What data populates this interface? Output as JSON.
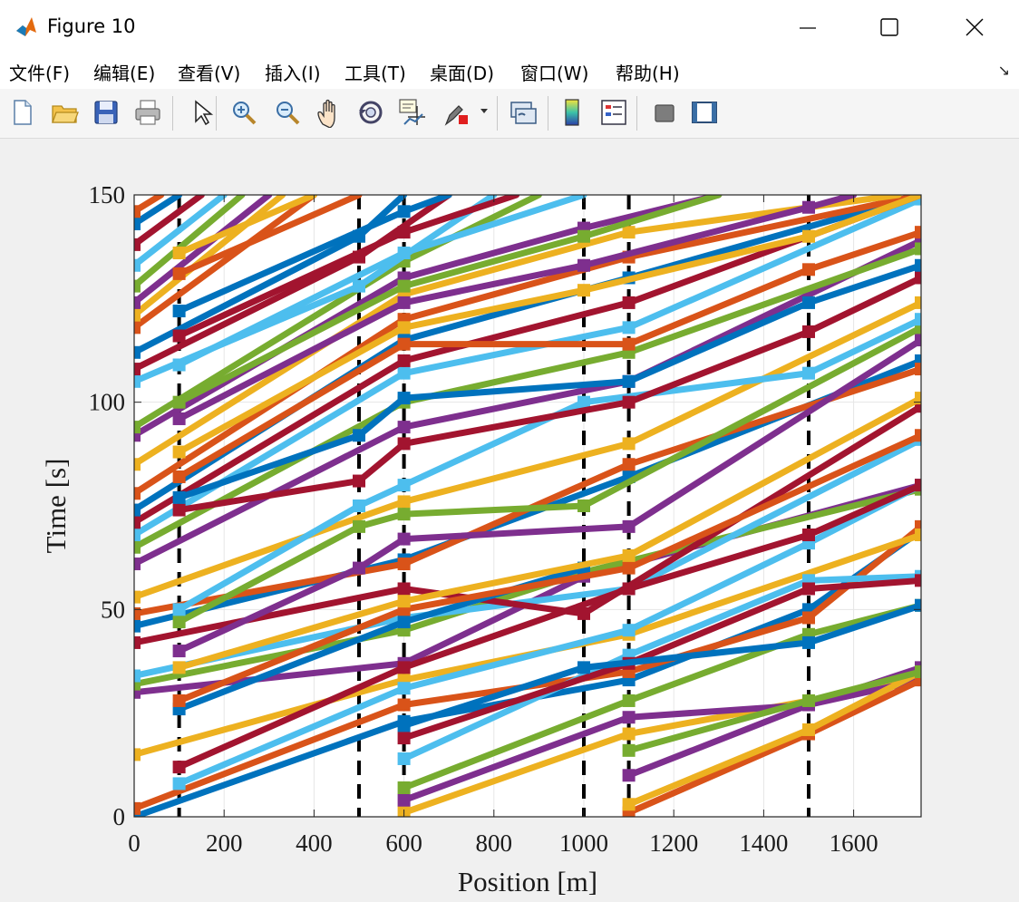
{
  "window": {
    "title": "Figure 10"
  },
  "menu": [
    {
      "label": "文件(F)",
      "x": 10
    },
    {
      "label": "编辑(E)",
      "x": 103
    },
    {
      "label": "查看(V)",
      "x": 196
    },
    {
      "label": "插入(I)",
      "x": 292
    },
    {
      "label": "工具(T)",
      "x": 380
    },
    {
      "label": "桌面(D)",
      "x": 474
    },
    {
      "label": "窗口(W)",
      "x": 574
    },
    {
      "label": "帮助(H)",
      "x": 679
    }
  ],
  "toolbar": [
    {
      "name": "new-figure-icon"
    },
    {
      "name": "open-file-icon"
    },
    {
      "name": "save-icon"
    },
    {
      "name": "print-icon"
    },
    {
      "name": "pointer-icon"
    },
    {
      "name": "zoom-in-icon"
    },
    {
      "name": "zoom-out-icon"
    },
    {
      "name": "pan-icon"
    },
    {
      "name": "rotate-3d-icon"
    },
    {
      "name": "data-cursor-icon"
    },
    {
      "name": "brush-icon"
    },
    {
      "name": "link-plot-icon"
    },
    {
      "name": "colorbar-icon"
    },
    {
      "name": "legend-icon"
    },
    {
      "name": "hide-plot-tools-icon"
    },
    {
      "name": "show-plot-tools-icon"
    }
  ],
  "chart_data": {
    "type": "line",
    "xlabel": "Position [m]",
    "ylabel": "Time [s]",
    "xlim": [
      0,
      1750
    ],
    "ylim": [
      0,
      150
    ],
    "xticks": [
      "0",
      "200",
      "400",
      "600",
      "800",
      "1000",
      "1200",
      "1400",
      "1600"
    ],
    "yticks": [
      "0",
      "50",
      "100",
      "150"
    ],
    "grid": true,
    "signal_positions": [
      100,
      500,
      600,
      1000,
      1100,
      1500
    ],
    "color_cycle": [
      "#0072BD",
      "#D95319",
      "#EDB120",
      "#7E2F8E",
      "#77AC30",
      "#4DBEEE",
      "#A2142F"
    ],
    "vehicles": [
      {
        "segments": [
          [
            0,
            0
          ],
          [
            600,
            23
          ],
          [
            1100,
            33
          ],
          [
            1500,
            50
          ],
          [
            1750,
            69
          ]
        ]
      },
      {
        "segments": [
          [
            0,
            2
          ],
          [
            600,
            27
          ],
          [
            1100,
            35
          ],
          [
            1500,
            48
          ],
          [
            1750,
            70
          ]
        ]
      },
      {
        "segments": [
          [
            0,
            15
          ],
          [
            600,
            33
          ],
          [
            1100,
            44
          ],
          [
            1750,
            68
          ]
        ]
      },
      {
        "segments": [
          [
            0,
            30
          ],
          [
            600,
            37
          ],
          [
            1000,
            58
          ],
          [
            1750,
            80
          ]
        ]
      },
      {
        "segments": [
          [
            0,
            32
          ],
          [
            600,
            45
          ],
          [
            1000,
            59
          ],
          [
            1750,
            79
          ]
        ]
      },
      {
        "segments": [
          [
            0,
            34
          ],
          [
            600,
            48
          ],
          [
            1100,
            55
          ],
          [
            1750,
            91
          ]
        ]
      },
      {
        "segments": [
          [
            0,
            42
          ],
          [
            600,
            55
          ],
          [
            1000,
            49
          ],
          [
            1750,
            99
          ]
        ]
      },
      {
        "segments": [
          [
            0,
            46
          ],
          [
            600,
            62
          ],
          [
            1100,
            82
          ],
          [
            1750,
            110
          ]
        ]
      },
      {
        "segments": [
          [
            0,
            49
          ],
          [
            600,
            61
          ],
          [
            1100,
            85
          ],
          [
            1750,
            108
          ]
        ]
      },
      {
        "segments": [
          [
            0,
            53
          ],
          [
            600,
            76
          ],
          [
            1100,
            90
          ],
          [
            1750,
            124
          ]
        ]
      },
      {
        "segments": [
          [
            0,
            61
          ],
          [
            600,
            94
          ],
          [
            1100,
            105
          ],
          [
            1750,
            139
          ]
        ]
      },
      {
        "segments": [
          [
            0,
            65
          ],
          [
            600,
            100
          ],
          [
            1100,
            112
          ],
          [
            1750,
            137
          ]
        ]
      },
      {
        "segments": [
          [
            0,
            68
          ],
          [
            600,
            107
          ],
          [
            1100,
            118
          ],
          [
            1750,
            149
          ]
        ]
      },
      {
        "segments": [
          [
            0,
            71
          ],
          [
            600,
            110
          ],
          [
            1100,
            124
          ],
          [
            1750,
            150
          ]
        ]
      },
      {
        "segments": [
          [
            0,
            74
          ],
          [
            600,
            115
          ],
          [
            1100,
            130
          ],
          [
            1750,
            150
          ]
        ]
      },
      {
        "segments": [
          [
            0,
            78
          ],
          [
            600,
            120
          ],
          [
            1100,
            135
          ],
          [
            1750,
            150
          ]
        ]
      },
      {
        "segments": [
          [
            0,
            85
          ],
          [
            600,
            126
          ],
          [
            1100,
            141
          ],
          [
            1700,
            150
          ]
        ]
      },
      {
        "segments": [
          [
            0,
            92
          ],
          [
            600,
            130
          ],
          [
            1000,
            142
          ],
          [
            1300,
            150
          ]
        ]
      },
      {
        "segments": [
          [
            0,
            94
          ],
          [
            600,
            134
          ],
          [
            900,
            150
          ]
        ]
      },
      {
        "segments": [
          [
            0,
            105
          ],
          [
            500,
            128
          ],
          [
            800,
            150
          ]
        ]
      },
      {
        "segments": [
          [
            0,
            108
          ],
          [
            500,
            135
          ],
          [
            700,
            150
          ]
        ]
      },
      {
        "segments": [
          [
            0,
            112
          ],
          [
            500,
            140
          ],
          [
            600,
            150
          ]
        ]
      },
      {
        "segments": [
          [
            0,
            118
          ],
          [
            400,
            150
          ]
        ]
      },
      {
        "segments": [
          [
            0,
            121
          ],
          [
            330,
            150
          ]
        ]
      },
      {
        "segments": [
          [
            0,
            124
          ],
          [
            300,
            150
          ]
        ]
      },
      {
        "segments": [
          [
            0,
            128
          ],
          [
            240,
            150
          ]
        ]
      },
      {
        "segments": [
          [
            0,
            133
          ],
          [
            200,
            150
          ]
        ]
      },
      {
        "segments": [
          [
            0,
            138
          ],
          [
            150,
            150
          ]
        ]
      },
      {
        "segments": [
          [
            0,
            143
          ],
          [
            100,
            150
          ]
        ]
      },
      {
        "segments": [
          [
            0,
            146
          ],
          [
            60,
            150
          ]
        ]
      },
      {
        "segments": [
          [
            600,
            1
          ],
          [
            1100,
            20
          ],
          [
            1500,
            28
          ],
          [
            1750,
            34
          ]
        ]
      },
      {
        "segments": [
          [
            600,
            4
          ],
          [
            1100,
            24
          ],
          [
            1500,
            27
          ],
          [
            1750,
            33
          ]
        ]
      },
      {
        "segments": [
          [
            600,
            7
          ],
          [
            1100,
            28
          ],
          [
            1500,
            44
          ],
          [
            1750,
            51
          ]
        ]
      },
      {
        "segments": [
          [
            600,
            14
          ],
          [
            1100,
            39
          ],
          [
            1500,
            57
          ],
          [
            1750,
            58
          ]
        ]
      },
      {
        "segments": [
          [
            600,
            19
          ],
          [
            1100,
            37
          ],
          [
            1500,
            55
          ],
          [
            1750,
            57
          ]
        ]
      },
      {
        "segments": [
          [
            600,
            22
          ],
          [
            1000,
            36
          ],
          [
            1500,
            42
          ],
          [
            1750,
            51
          ]
        ]
      },
      {
        "segments": [
          [
            1100,
            1
          ],
          [
            1500,
            20
          ],
          [
            1750,
            33
          ]
        ]
      },
      {
        "segments": [
          [
            1100,
            3
          ],
          [
            1500,
            21
          ],
          [
            1750,
            35
          ]
        ]
      },
      {
        "segments": [
          [
            1100,
            10
          ],
          [
            1500,
            27
          ],
          [
            1750,
            36
          ]
        ]
      },
      {
        "segments": [
          [
            1100,
            16
          ],
          [
            1500,
            28
          ],
          [
            1750,
            35
          ]
        ]
      },
      {
        "segments": [
          [
            100,
            8
          ],
          [
            600,
            31
          ],
          [
            1100,
            45
          ],
          [
            1500,
            66
          ],
          [
            1750,
            80
          ]
        ]
      },
      {
        "segments": [
          [
            100,
            12
          ],
          [
            600,
            36
          ],
          [
            1100,
            55
          ],
          [
            1500,
            68
          ],
          [
            1750,
            80
          ]
        ]
      },
      {
        "segments": [
          [
            100,
            26
          ],
          [
            600,
            47
          ],
          [
            1000,
            60
          ]
        ]
      },
      {
        "segments": [
          [
            100,
            28
          ],
          [
            600,
            50
          ],
          [
            1100,
            60
          ],
          [
            1750,
            92
          ]
        ]
      },
      {
        "segments": [
          [
            100,
            36
          ],
          [
            600,
            52
          ],
          [
            1100,
            63
          ],
          [
            1750,
            101
          ]
        ]
      },
      {
        "segments": [
          [
            100,
            40
          ],
          [
            500,
            60
          ],
          [
            600,
            67
          ],
          [
            1100,
            70
          ],
          [
            1750,
            115
          ]
        ]
      },
      {
        "segments": [
          [
            100,
            47
          ],
          [
            500,
            70
          ],
          [
            600,
            73
          ],
          [
            1000,
            75
          ],
          [
            1750,
            118
          ]
        ]
      },
      {
        "segments": [
          [
            100,
            50
          ],
          [
            500,
            75
          ],
          [
            600,
            80
          ],
          [
            1000,
            100
          ],
          [
            1500,
            107
          ],
          [
            1750,
            120
          ]
        ]
      },
      {
        "segments": [
          [
            100,
            74
          ],
          [
            500,
            81
          ],
          [
            600,
            90
          ],
          [
            1100,
            100
          ],
          [
            1500,
            117
          ],
          [
            1750,
            130
          ]
        ]
      },
      {
        "segments": [
          [
            100,
            77
          ],
          [
            500,
            92
          ],
          [
            600,
            101
          ],
          [
            1100,
            105
          ],
          [
            1500,
            124
          ],
          [
            1750,
            133
          ]
        ]
      },
      {
        "segments": [
          [
            100,
            82
          ],
          [
            600,
            114
          ],
          [
            1100,
            114
          ],
          [
            1500,
            132
          ],
          [
            1750,
            141
          ]
        ]
      },
      {
        "segments": [
          [
            100,
            88
          ],
          [
            600,
            118
          ],
          [
            1000,
            127
          ],
          [
            1500,
            140
          ],
          [
            1750,
            150
          ]
        ]
      },
      {
        "segments": [
          [
            100,
            96
          ],
          [
            600,
            124
          ],
          [
            1000,
            133
          ],
          [
            1500,
            147
          ],
          [
            1600,
            150
          ]
        ]
      },
      {
        "segments": [
          [
            100,
            100
          ],
          [
            600,
            128
          ],
          [
            1000,
            140
          ],
          [
            1300,
            150
          ]
        ]
      },
      {
        "segments": [
          [
            100,
            109
          ],
          [
            600,
            136
          ],
          [
            1000,
            150
          ]
        ]
      },
      {
        "segments": [
          [
            100,
            116
          ],
          [
            600,
            141
          ],
          [
            850,
            150
          ]
        ]
      },
      {
        "segments": [
          [
            100,
            122
          ],
          [
            600,
            146
          ],
          [
            700,
            150
          ]
        ]
      },
      {
        "segments": [
          [
            100,
            131
          ],
          [
            500,
            150
          ]
        ]
      },
      {
        "segments": [
          [
            100,
            136
          ],
          [
            400,
            150
          ]
        ]
      }
    ]
  }
}
